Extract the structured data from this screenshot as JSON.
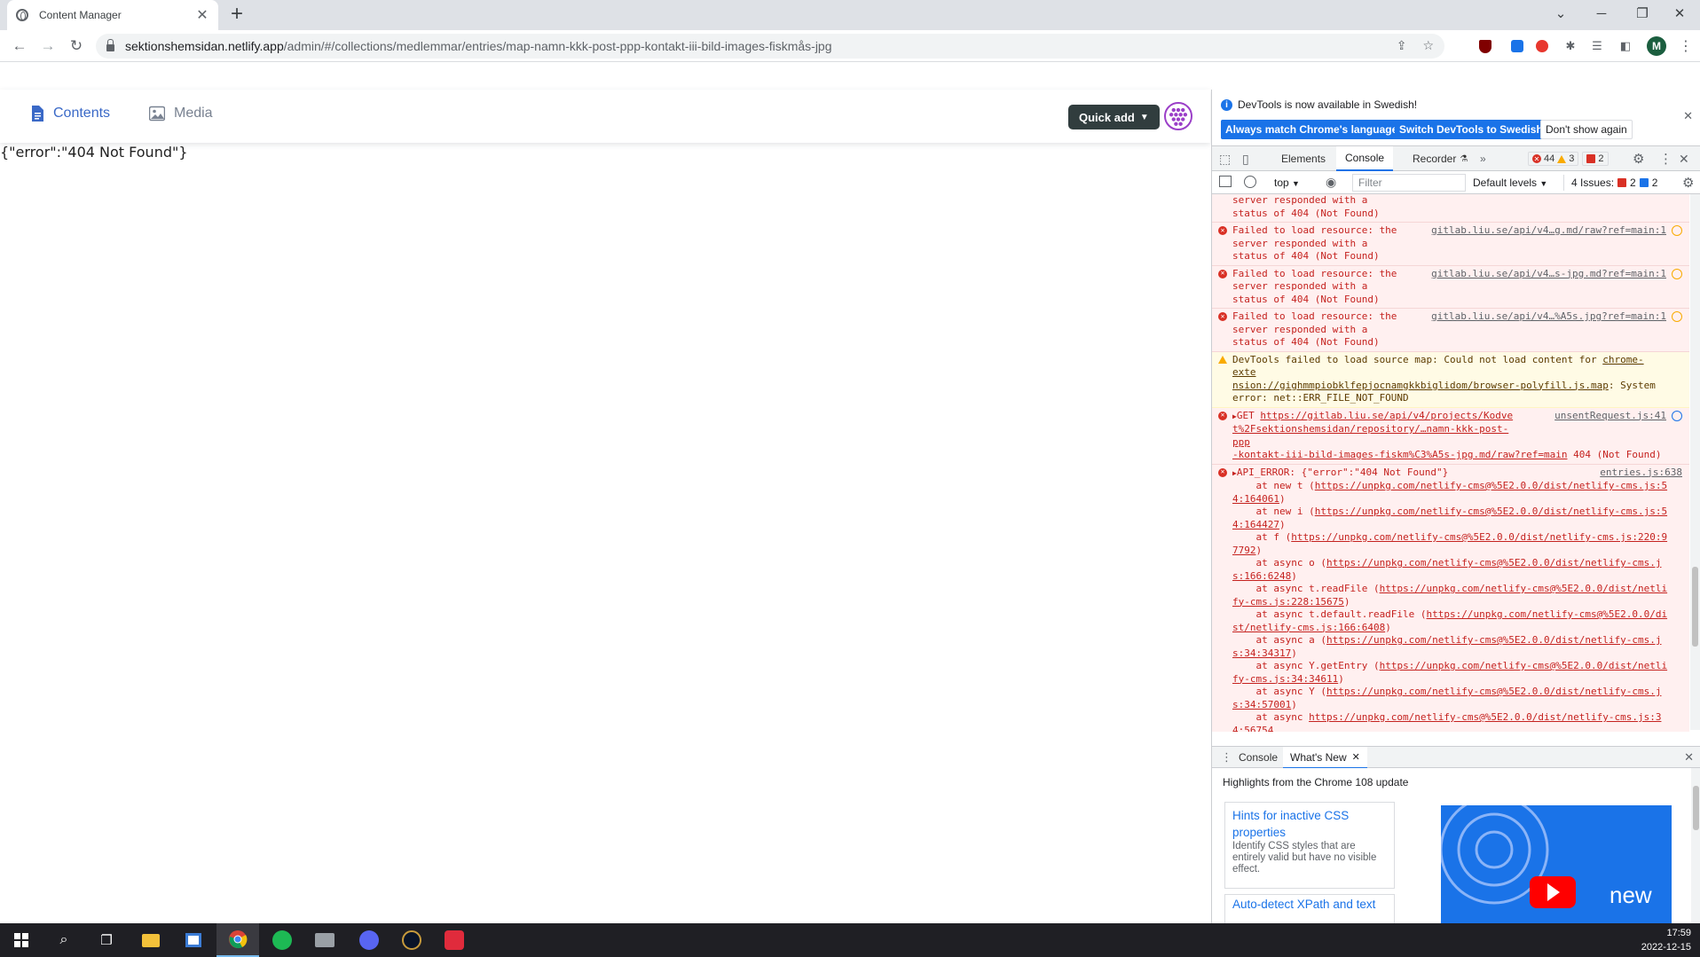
{
  "browser": {
    "tab_title": "Content Manager",
    "url_host": "sektionshemsidan.netlify.app",
    "url_path": "/admin/#/collections/medlemmar/entries/map-namn-kkk-post-ppp-kontakt-iii-bild-images-fiskmås-jpg",
    "profile_initial": "M"
  },
  "cms": {
    "nav_contents": "Contents",
    "nav_media": "Media",
    "quick_add": "Quick add",
    "error_body": "{\"error\":\"404 Not Found\"}",
    "accent_color": "#3a69c7"
  },
  "devtools": {
    "info_message": "DevTools is now available in Swedish!",
    "btn_match": "Always match Chrome's language",
    "btn_switch": "Switch DevTools to Swedish",
    "btn_dont_show": "Don't show again",
    "tabs": {
      "elements": "Elements",
      "console": "Console",
      "recorder": "Recorder"
    },
    "counts": {
      "errors": "44",
      "warnings": "3",
      "issues_badge": "2"
    },
    "filterbar": {
      "context": "top",
      "filter_placeholder": "Filter",
      "levels": "Default levels",
      "issues_label": "4 Issues:",
      "issues_errors": "2",
      "issues_info": "2"
    },
    "console": {
      "entry0_tail1": "server responded with a",
      "entry0_tail2": "status of 404 (Not Found)",
      "fail1": "Failed to load resource: the",
      "fail2": "server responded with a",
      "fail3": "status of 404 (Not Found)",
      "src1": "gitlab.liu.se/api/v4…g.md/raw?ref=main:1",
      "src2": "gitlab.liu.se/api/v4…s-jpg.md?ref=main:1",
      "src3": "gitlab.liu.se/api/v4…%A5s.jpg?ref=main:1",
      "warn_l1a": "DevTools failed to load source map: Could not load content for ",
      "warn_l1b": "chrome-exte",
      "warn_l2a": "nsion://gighmmpiobklfepjocnamgkkbiglidom/browser-polyfill.js.map",
      "warn_l2b": ": System",
      "warn_l3": "error: net::ERR_FILE_NOT_FOUND",
      "get_l1a": "GET ",
      "get_l1b": "https://gitlab.liu.se/api/v4/projects/Kodve",
      "get_l2": "t%2Fsektionshemsidan/repository/…namn-kkk-post-ppp",
      "get_l3a": "-kontakt-iii-bild-images-fiskm%C3%A5s-jpg.md/raw?ref=main",
      "get_l3b": " 404 (Not Found)",
      "get_src": "unsentRequest.js:41",
      "api_error": "API_ERROR: {\"error\":\"404 Not Found\"}",
      "api_src": "entries.js:638",
      "stack": [
        {
          "pre": "    at new t (",
          "l1": "https://unpkg.com/netlify-cms@%5E2.0.0/dist/netlify-cms.js:5",
          "l2": "4:164061",
          "post": ")"
        },
        {
          "pre": "    at new i (",
          "l1": "https://unpkg.com/netlify-cms@%5E2.0.0/dist/netlify-cms.js:5",
          "l2": "4:164427",
          "post": ")"
        },
        {
          "pre": "    at f (",
          "l1": "https://unpkg.com/netlify-cms@%5E2.0.0/dist/netlify-cms.js:220:9",
          "l2": "7792",
          "post": ")"
        },
        {
          "pre": "    at async o (",
          "l1": "https://unpkg.com/netlify-cms@%5E2.0.0/dist/netlify-cms.j",
          "l2": "s:166:6248",
          "post": ")"
        },
        {
          "pre": "    at async t.readFile (",
          "l1": "https://unpkg.com/netlify-cms@%5E2.0.0/dist/netli",
          "l2": "fy-cms.js:228:15675",
          "post": ")"
        },
        {
          "pre": "    at async t.default.readFile (",
          "l1": "https://unpkg.com/netlify-cms@%5E2.0.0/di",
          "l2": "st/netlify-cms.js:166:6408",
          "post": ")"
        },
        {
          "pre": "    at async a (",
          "l1": "https://unpkg.com/netlify-cms@%5E2.0.0/dist/netlify-cms.j",
          "l2": "s:34:34317",
          "post": ")"
        },
        {
          "pre": "    at async Y.getEntry (",
          "l1": "https://unpkg.com/netlify-cms@%5E2.0.0/dist/netli",
          "l2": "fy-cms.js:34:34611",
          "post": ")"
        },
        {
          "pre": "    at async Y (",
          "l1": "https://unpkg.com/netlify-cms@%5E2.0.0/dist/netlify-cms.j",
          "l2": "s:34:57001",
          "post": ")"
        },
        {
          "pre": "    at async ",
          "l1": "https://unpkg.com/netlify-cms@%5E2.0.0/dist/netlify-cms.js:3",
          "l2": "4:56754",
          "post": ""
        }
      ]
    },
    "drawer": {
      "tab_console": "Console",
      "tab_whats_new": "What's New",
      "highlights": "Highlights from the Chrome 108 update",
      "card1_title_a": "Hints for inactive CSS",
      "card1_title_b": "properties",
      "card1_desc": "Identify CSS styles that are entirely valid but have no visible effect.",
      "card2_title": "Auto-detect XPath and text",
      "video_text": "new"
    }
  },
  "taskbar": {
    "time": "17:59",
    "date": "2022-12-15"
  }
}
